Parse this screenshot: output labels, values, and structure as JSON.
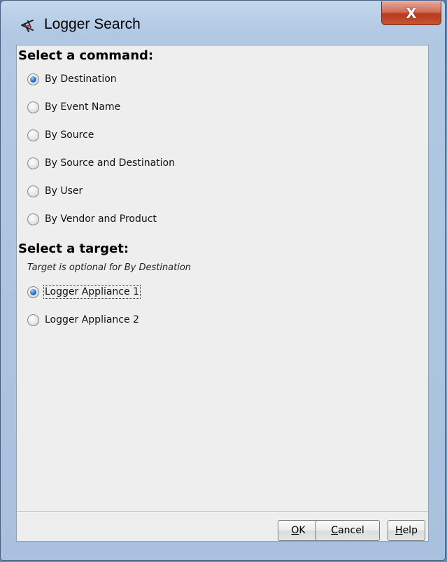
{
  "window": {
    "title": "Logger Search",
    "close_glyph": "X"
  },
  "command": {
    "heading": "Select a command:",
    "options": [
      {
        "label": "By Destination",
        "selected": true
      },
      {
        "label": "By Event Name",
        "selected": false
      },
      {
        "label": "By Source",
        "selected": false
      },
      {
        "label": "By Source and Destination",
        "selected": false
      },
      {
        "label": "By User",
        "selected": false
      },
      {
        "label": "By Vendor and Product",
        "selected": false
      }
    ]
  },
  "target": {
    "heading": "Select a target:",
    "note": "Target is optional for By Destination",
    "options": [
      {
        "label": "Logger Appliance 1",
        "selected": true
      },
      {
        "label": "Logger Appliance 2",
        "selected": false
      }
    ]
  },
  "buttons": {
    "ok": {
      "mnemonic": "O",
      "rest": "K"
    },
    "cancel": {
      "mnemonic": "C",
      "rest": "ancel"
    },
    "help": {
      "mnemonic": "H",
      "rest": "elp"
    }
  },
  "icons": {
    "app": "logger-search-icon",
    "close": "close-icon"
  },
  "colors": {
    "close_button": "#c9452b",
    "radio_selected": "#2f7fd4",
    "dialog_bg": "#eeeeee"
  }
}
